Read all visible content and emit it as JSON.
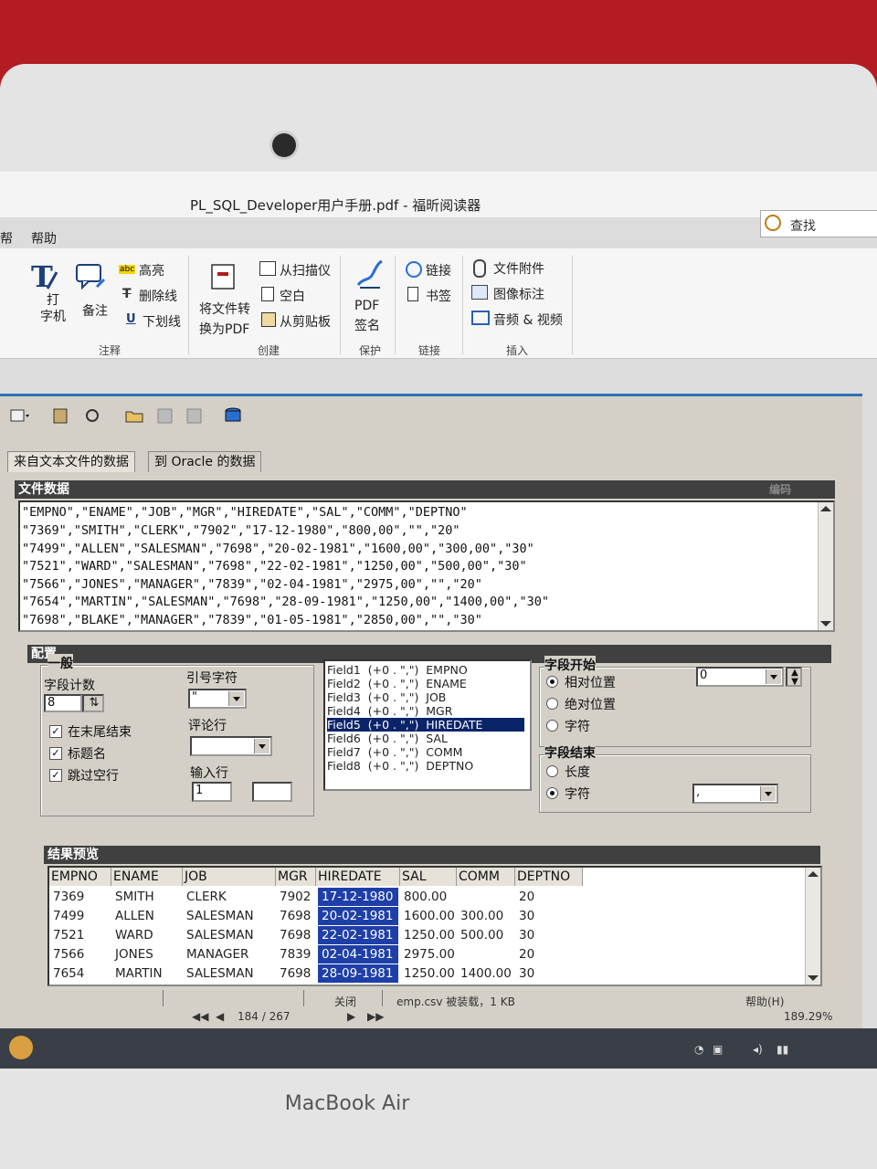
{
  "laptop": {
    "brand": "MacBook Air"
  },
  "foxit": {
    "title": "PL_SQL_Developer用户手册.pdf - 福昕阅读器",
    "menu": {
      "partial": "帮",
      "help": "帮助"
    },
    "search_label": "查找",
    "ribbon": {
      "typewriter": "打\n字机",
      "note": "备注",
      "highlight": "高亮",
      "strike": "删除线",
      "underline": "下划线",
      "group_annot": "注释",
      "convert": "将文件转\n换为PDF",
      "from_scanner": "从扫描仪",
      "blank": "空白",
      "from_clipboard": "从剪贴板",
      "group_create": "创建",
      "pdf_sign": "PDF\n签名",
      "group_protect": "保护",
      "link": "链接",
      "bookmark": "书签",
      "group_link": "链接",
      "attachment": "文件附件",
      "image_annot": "图像标注",
      "av": "音频 & 视频",
      "group_insert": "插入"
    },
    "nav": {
      "page": "184 / 267",
      "zoom": "189.29%"
    }
  },
  "plsql": {
    "tabs": [
      "来自文本文件的数据",
      "到 Oracle 的数据"
    ],
    "file_section": {
      "title": "文件数据",
      "badge": "编码",
      "lines": [
        "\"EMPNO\",\"ENAME\",\"JOB\",\"MGR\",\"HIREDATE\",\"SAL\",\"COMM\",\"DEPTNO\"",
        "\"7369\",\"SMITH\",\"CLERK\",\"7902\",\"17-12-1980\",\"800,00\",\"\",\"20\"",
        "\"7499\",\"ALLEN\",\"SALESMAN\",\"7698\",\"20-02-1981\",\"1600,00\",\"300,00\",\"30\"",
        "\"7521\",\"WARD\",\"SALESMAN\",\"7698\",\"22-02-1981\",\"1250,00\",\"500,00\",\"30\"",
        "\"7566\",\"JONES\",\"MANAGER\",\"7839\",\"02-04-1981\",\"2975,00\",\"\",\"20\"",
        "\"7654\",\"MARTIN\",\"SALESMAN\",\"7698\",\"28-09-1981\",\"1250,00\",\"1400,00\",\"30\"",
        "\"7698\",\"BLAKE\",\"MANAGER\",\"7839\",\"01-05-1981\",\"2850,00\",\"\",\"30\""
      ]
    },
    "config": {
      "title": "配置",
      "general": "一般",
      "field_count_label": "字段计数",
      "field_count": "8",
      "quote_label": "引号字符",
      "quote_value": "\"",
      "comment_label": "评论行",
      "input_label": "输入行",
      "input_value": "1",
      "chk_end": "在末尾结束",
      "chk_header": "标题名",
      "chk_skip": "跳过空行",
      "fields": [
        "Field1  (+0 . \",\")  EMPNO",
        "Field2  (+0 . \",\")  ENAME",
        "Field3  (+0 . \",\")  JOB",
        "Field4  (+0 . \",\")  MGR",
        "Field5  (+0 . \",\")  HIREDATE",
        "Field6  (+0 . \",\")  SAL",
        "Field7  (+0 . \",\")  COMM",
        "Field8  (+0 . \",\")  DEPTNO"
      ],
      "selected_field_index": 4,
      "field_start": "字段开始",
      "relative": "相对位置",
      "absolute": "绝对位置",
      "char1": "字符",
      "start_value": "0",
      "field_end": "字段结束",
      "length": "长度",
      "char2": "字符",
      "end_value": ","
    },
    "preview": {
      "title": "结果预览",
      "columns": [
        "EMPNO",
        "ENAME",
        "JOB",
        "MGR",
        "HIREDATE",
        "SAL",
        "COMM",
        "DEPTNO"
      ],
      "rows": [
        [
          "7369",
          "SMITH",
          "CLERK",
          "7902",
          "17-12-1980",
          "800.00",
          "",
          "20"
        ],
        [
          "7499",
          "ALLEN",
          "SALESMAN",
          "7698",
          "20-02-1981",
          "1600.00",
          "300.00",
          "30"
        ],
        [
          "7521",
          "WARD",
          "SALESMAN",
          "7698",
          "22-02-1981",
          "1250.00",
          "500.00",
          "30"
        ],
        [
          "7566",
          "JONES",
          "MANAGER",
          "7839",
          "02-04-1981",
          "2975.00",
          "",
          "20"
        ],
        [
          "7654",
          "MARTIN",
          "SALESMAN",
          "7698",
          "28-09-1981",
          "1250.00",
          "1400.00",
          "30"
        ]
      ]
    },
    "status": {
      "close": "关闭",
      "file": "emp.csv 被装载，1 KB",
      "help": "帮助(H)"
    }
  },
  "colors": {
    "hiredate_bg": "#1f3fa8",
    "selection": "#0a246a"
  }
}
